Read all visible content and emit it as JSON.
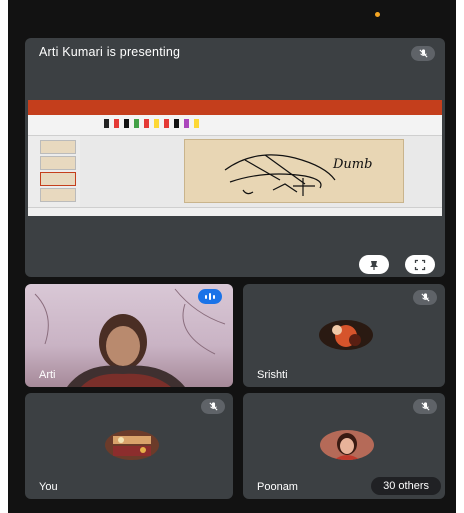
{
  "meeting": {
    "presenter_label": "Arti Kumari is presenting",
    "others_count_label": "30 others"
  },
  "participants": [
    {
      "name": "Arti",
      "state": "speaking",
      "video": "on"
    },
    {
      "name": "Srishti",
      "state": "muted",
      "video": "off"
    },
    {
      "name": "You",
      "state": "muted",
      "video": "off"
    },
    {
      "name": "Poonam",
      "state": "muted",
      "video": "off"
    }
  ],
  "slide": {
    "handwriting": "Dumb"
  },
  "icons": {
    "mic_muted": "mic-off-icon",
    "pin": "pin-icon",
    "fullscreen": "fullscreen-icon",
    "speaking": "audio-level-icon"
  },
  "colors": {
    "tile": "#3c4043",
    "background": "#121212",
    "ppt_accent": "#c43e1c",
    "speaking_badge": "#1a73e8"
  }
}
